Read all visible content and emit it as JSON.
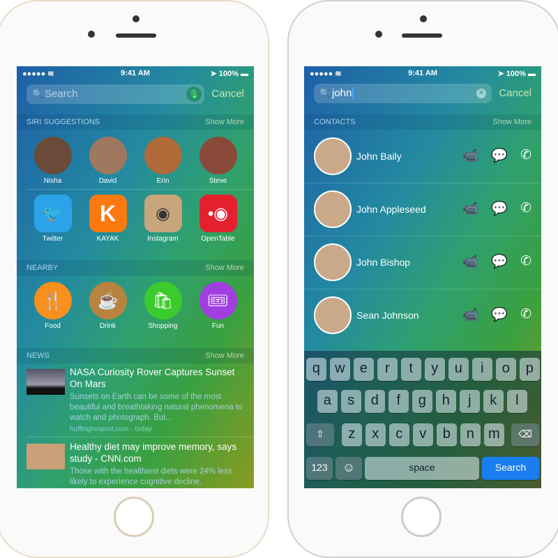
{
  "left": {
    "status": {
      "time": "9:41 AM",
      "battery": "100%"
    },
    "search": {
      "placeholder": "Search",
      "cancel": "Cancel"
    },
    "siri": {
      "title": "SIRI SUGGESTIONS",
      "more": "Show More",
      "contacts": [
        {
          "name": "Nisha"
        },
        {
          "name": "David"
        },
        {
          "name": "Erin"
        },
        {
          "name": "Steve"
        }
      ],
      "apps": [
        {
          "name": "Twitter",
          "color": "#2aa3e8",
          "glyph": "🐦"
        },
        {
          "name": "KAYAK",
          "color": "#fa7a10",
          "glyph": "K"
        },
        {
          "name": "Instagram",
          "color": "#c9a57c",
          "glyph": "◉"
        },
        {
          "name": "OpenTable",
          "color": "#e5202e",
          "glyph": "•◉"
        }
      ]
    },
    "nearby": {
      "title": "NEARBY",
      "more": "Show More",
      "items": [
        {
          "name": "Food",
          "color": "#f7901e",
          "glyph": "🍴"
        },
        {
          "name": "Drink",
          "color": "#b8833e",
          "glyph": "☕"
        },
        {
          "name": "Shopping",
          "color": "#3ccb2c",
          "glyph": "🛍"
        },
        {
          "name": "Fun",
          "color": "#a03ee0",
          "glyph": "🎟"
        }
      ]
    },
    "news": {
      "title": "NEWS",
      "more": "Show More",
      "items": [
        {
          "headline": "NASA Curiosity Rover Captures Sunset On Mars",
          "desc": "Sunsets on Earth can be some of the most beautiful and breathtaking natural phenomena to watch and photograph. But...",
          "source": "huffingtonpost.com - today"
        },
        {
          "headline": "Healthy diet may improve memory, says study - CNN.com",
          "desc": "Those with the healthiest diets were 24% less likely to experience cognitive decline."
        }
      ]
    }
  },
  "right": {
    "status": {
      "time": "9:41 AM",
      "battery": "100%"
    },
    "search": {
      "value": "john",
      "cancel": "Cancel"
    },
    "contacts": {
      "title": "CONTACTS",
      "more": "Show More",
      "items": [
        {
          "name": "John Baily"
        },
        {
          "name": "John Appleseed"
        },
        {
          "name": "John Bishop"
        },
        {
          "name": "Sean Johnson"
        }
      ]
    },
    "keyboard": {
      "row1": [
        "q",
        "w",
        "e",
        "r",
        "t",
        "y",
        "u",
        "i",
        "o",
        "p"
      ],
      "row2": [
        "a",
        "s",
        "d",
        "f",
        "g",
        "h",
        "j",
        "k",
        "l"
      ],
      "row3": [
        "z",
        "x",
        "c",
        "v",
        "b",
        "n",
        "m"
      ],
      "numbers": "123",
      "space": "space",
      "search": "Search"
    }
  }
}
